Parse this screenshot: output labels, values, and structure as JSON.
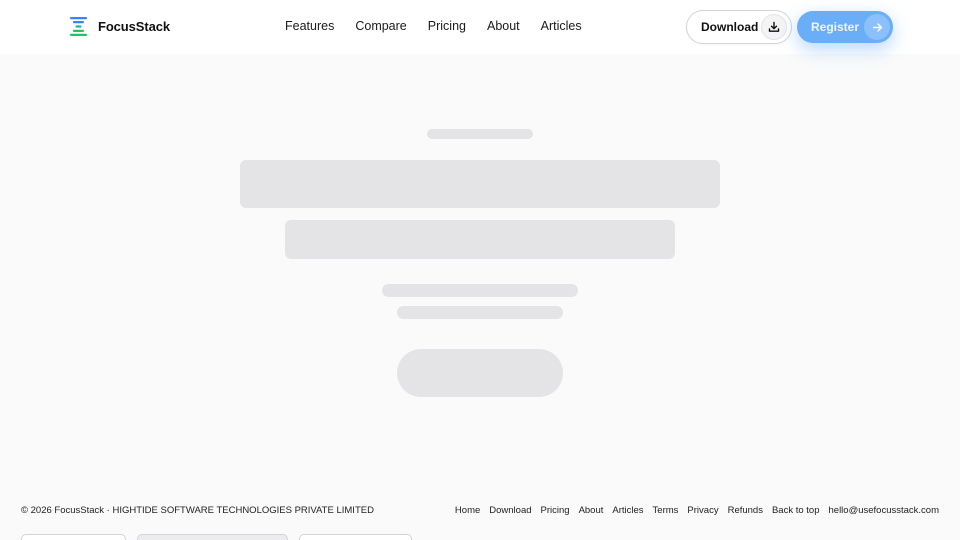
{
  "brand": {
    "name": "FocusStack"
  },
  "nav": {
    "items": [
      {
        "label": "Features"
      },
      {
        "label": "Compare"
      },
      {
        "label": "Pricing"
      },
      {
        "label": "About"
      },
      {
        "label": "Articles"
      }
    ]
  },
  "header": {
    "download_label": "Download",
    "register_label": "Register"
  },
  "icons": {
    "logo": "stack-logo-icon",
    "download": "download-icon",
    "register": "arrow-right-icon"
  },
  "colors": {
    "accent": "#6aaef7",
    "skeleton": "#e4e4e7",
    "background": "#fafafa"
  },
  "footer": {
    "copyright": "© 2026 FocusStack · HIGHTIDE SOFTWARE TECHNOLOGIES PRIVATE LIMITED",
    "links": [
      {
        "label": "Home"
      },
      {
        "label": "Download"
      },
      {
        "label": "Pricing"
      },
      {
        "label": "About"
      },
      {
        "label": "Articles"
      },
      {
        "label": "Terms"
      },
      {
        "label": "Privacy"
      },
      {
        "label": "Refunds"
      },
      {
        "label": "Back to top"
      },
      {
        "label": "hello@usefocusstack.com"
      }
    ]
  }
}
